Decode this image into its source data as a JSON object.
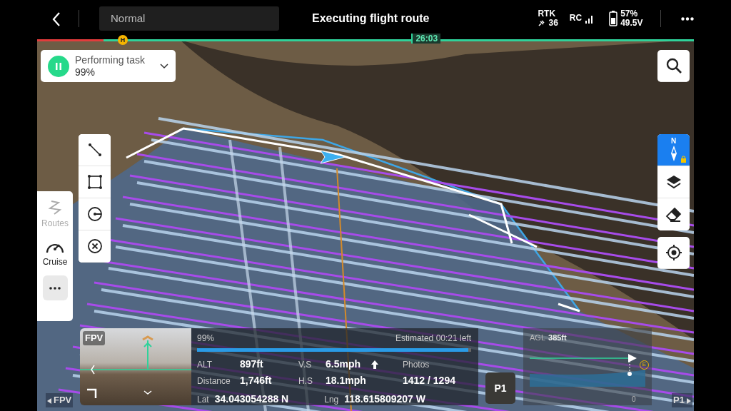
{
  "top_bar": {
    "mode": "Normal",
    "title": "Executing flight route",
    "rtk_label": "RTK",
    "rtk_count": "36",
    "rc_label": "RC",
    "battery_percent": "57%",
    "battery_voltage": "49.5V"
  },
  "timeline": {
    "home_marker": "H",
    "time": "26:03",
    "level": 0.57
  },
  "task_card": {
    "title": "Performing task",
    "percent": "99%"
  },
  "left_tools": [
    {
      "label": "Routes",
      "disabled": true
    },
    {
      "label": "Cruise",
      "disabled": false
    }
  ],
  "compass_label": "N",
  "flight_panel": {
    "fpv_label": "FPV",
    "progress_text": "99%",
    "level": 0.99,
    "remaining": "Estimated 00:21 left",
    "rows": [
      [
        {
          "label": "ALT",
          "value": "897ft"
        },
        {
          "label": "V.S",
          "value": "6.5mph"
        },
        {
          "label": "Photos"
        }
      ],
      [
        {
          "label": "Distance",
          "value": "1,746ft"
        },
        {
          "label": "H.S",
          "value": "18.1mph"
        },
        {
          "value": "1412 / 1294"
        }
      ]
    ],
    "lat_label": "Lat",
    "lat": "34.043054288 N",
    "lng_label": "Lng",
    "lng": "118.615809207 W"
  },
  "p1_button": "P1",
  "agl_chart": {
    "label": "AGL",
    "value": "385",
    "unit": "ft",
    "axis_zero": "0",
    "end_marker": "E"
  },
  "map_labels": [
    {
      "text": "FPV"
    },
    {
      "text": "P1"
    }
  ]
}
